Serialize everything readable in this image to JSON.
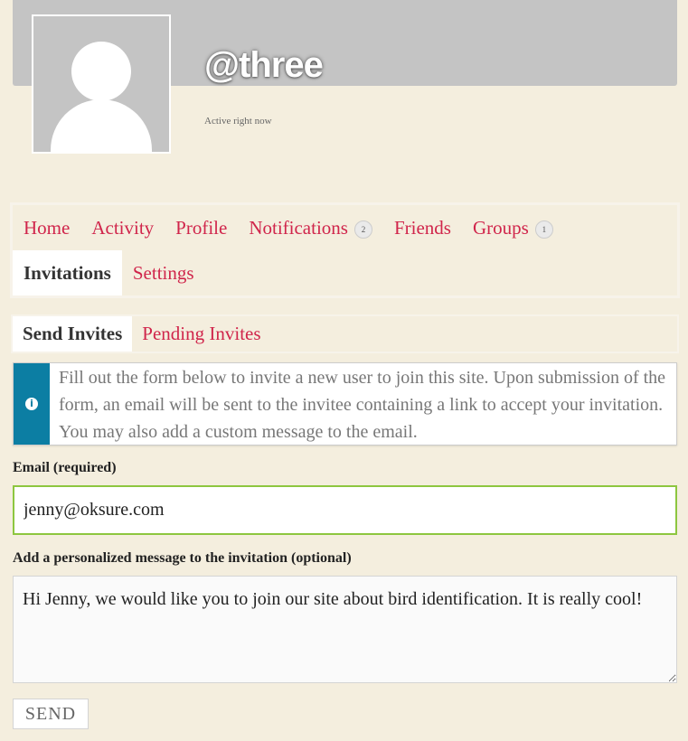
{
  "profile": {
    "username": "@three",
    "activity": "Active right now",
    "avatar_icon": "default-avatar-silhouette"
  },
  "main_nav": {
    "items": [
      {
        "label": "Home"
      },
      {
        "label": "Activity"
      },
      {
        "label": "Profile"
      },
      {
        "label": "Notifications",
        "count": "2"
      },
      {
        "label": "Friends"
      },
      {
        "label": "Groups",
        "count": "1"
      },
      {
        "label": "Invitations",
        "current": true
      },
      {
        "label": "Settings"
      }
    ]
  },
  "sub_nav": {
    "items": [
      {
        "label": "Send Invites",
        "current": true
      },
      {
        "label": "Pending Invites"
      }
    ]
  },
  "info": {
    "icon": "info-icon",
    "icon_glyph": "i",
    "text": "Fill out the form below to invite a new user to join this site. Upon submission of the form, an email will be sent to the invitee containing a link to accept your invitation. You may also add a custom message to the email."
  },
  "form": {
    "email_label": "Email (required)",
    "email_value": "jenny@oksure.com",
    "message_label": "Add a personalized message to the invitation (optional)",
    "message_value": "Hi Jenny, we would like you to join our site about bird identification. It is really cool!",
    "send_label": "SEND"
  },
  "colors": {
    "background": "#f4eede",
    "link": "#d0254b",
    "info_bar": "#0c7ea3",
    "focus_border": "#8dc63f"
  }
}
